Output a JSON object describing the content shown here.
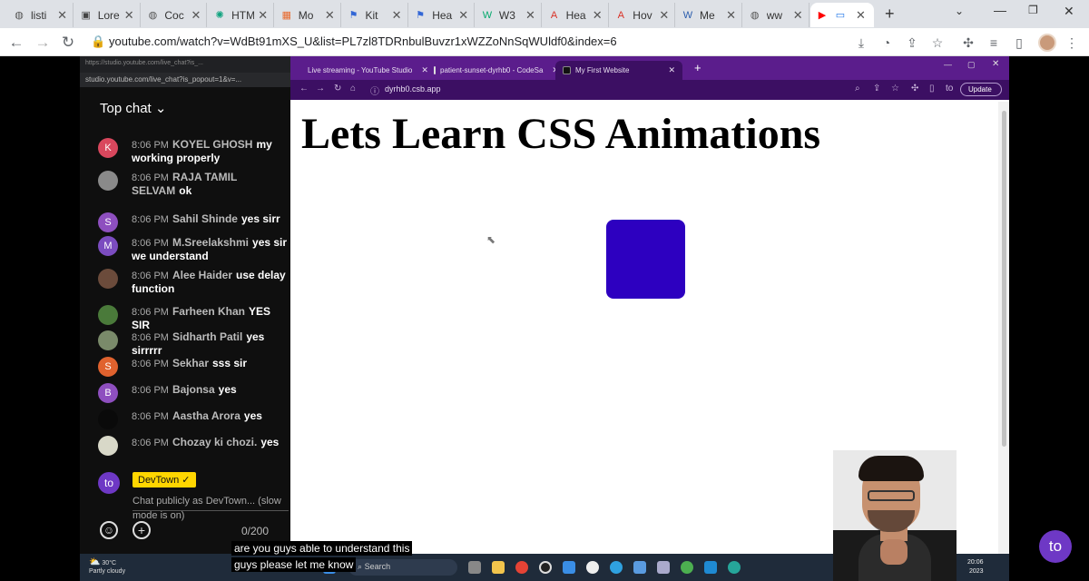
{
  "outer_browser": {
    "tabs": [
      {
        "title": "listi",
        "icon": "globe-icon"
      },
      {
        "title": "Lore",
        "icon": "car-icon"
      },
      {
        "title": "Coc",
        "icon": "globe-icon"
      },
      {
        "title": "HTM",
        "icon": "chatgpt-icon"
      },
      {
        "title": "Mo",
        "icon": "microsoft-icon"
      },
      {
        "title": "Kit",
        "icon": "flag-icon"
      },
      {
        "title": "Hea",
        "icon": "flag-icon"
      },
      {
        "title": "W3",
        "icon": "w3-icon"
      },
      {
        "title": "Hea",
        "icon": "pdf-icon"
      },
      {
        "title": "Hov",
        "icon": "pdf-icon"
      },
      {
        "title": "Me",
        "icon": "w3schools-icon"
      },
      {
        "title": "ww",
        "icon": "globe-icon"
      }
    ],
    "new_tab": "+",
    "url": "youtube.com/watch?v=WdBt91mXS_U&list=PL7zl8TDRnbulBuvzr1xWZZoNnSqWUldf0&index=6"
  },
  "chat": {
    "popup_title": "https://studio.youtube.com/live_chat?is_...",
    "popup_url": "studio.youtube.com/live_chat?is_popout=1&v=...",
    "header": "Top chat",
    "messages": [
      {
        "avatar": "K",
        "color": "#d9475d",
        "time": "8:06 PM",
        "name": "KOYEL GHOSH",
        "text": "my working properly"
      },
      {
        "avatar": "",
        "color": "#8a8a8a",
        "time": "8:06 PM",
        "name": "RAJA TAMIL SELVAM",
        "text": "ok"
      },
      {
        "avatar": "S",
        "color": "#8e4fbf",
        "time": "8:06 PM",
        "name": "Sahil Shinde",
        "text": "yes sirr"
      },
      {
        "avatar": "M",
        "color": "#7b4cc0",
        "time": "8:06 PM",
        "name": "M.Sreelakshmi",
        "text": "yes sir we understand"
      },
      {
        "avatar": "",
        "color": "#6b4b3b",
        "time": "8:06 PM",
        "name": "Alee Haider",
        "text": "use delay function"
      },
      {
        "avatar": "",
        "color": "#4a7a3a",
        "time": "8:06 PM",
        "name": "Farheen Khan",
        "text": "YES SIR"
      },
      {
        "avatar": "",
        "color": "#7a8a6a",
        "time": "8:06 PM",
        "name": "Sidharth Patil",
        "text": "yes sirrrrr"
      },
      {
        "avatar": "S",
        "color": "#e0622e",
        "time": "8:06 PM",
        "name": "Sekhar",
        "text": "sss sir"
      },
      {
        "avatar": "B",
        "color": "#8e4fbf",
        "time": "8:06 PM",
        "name": "Bajonsa",
        "text": "yes"
      },
      {
        "avatar": "",
        "color": "#0a0a0a",
        "time": "8:06 PM",
        "name": "Aastha Arora",
        "text": "yes"
      },
      {
        "avatar": "",
        "color": "#d8d8c8",
        "time": "8:06 PM",
        "name": "Chozay ki chozi.",
        "text": "yes"
      }
    ],
    "devtown_label": "DevTown ✓",
    "chat_public": "Chat publicly as DevTown... (slow mode is on)",
    "counter": "0/200"
  },
  "inner_browser": {
    "tabs": [
      {
        "title": "Live streaming - YouTube Studio"
      },
      {
        "title": "patient-sunset-dyrhb0 - CodeSa"
      },
      {
        "title": "My First Website"
      }
    ],
    "new_tab": "+",
    "url": "dyrhb0.csb.app",
    "update_label": "Update",
    "heading": "Lets Learn CSS Animations",
    "box_color": "#2d00c0"
  },
  "taskbar": {
    "temp": "30°C",
    "weather": "Partly cloudy",
    "search": "Search",
    "time": "20:06",
    "year": "2023"
  },
  "caption": {
    "line1": "are you guys able to understand this",
    "line2": "guys please let me know"
  },
  "logo": "to"
}
